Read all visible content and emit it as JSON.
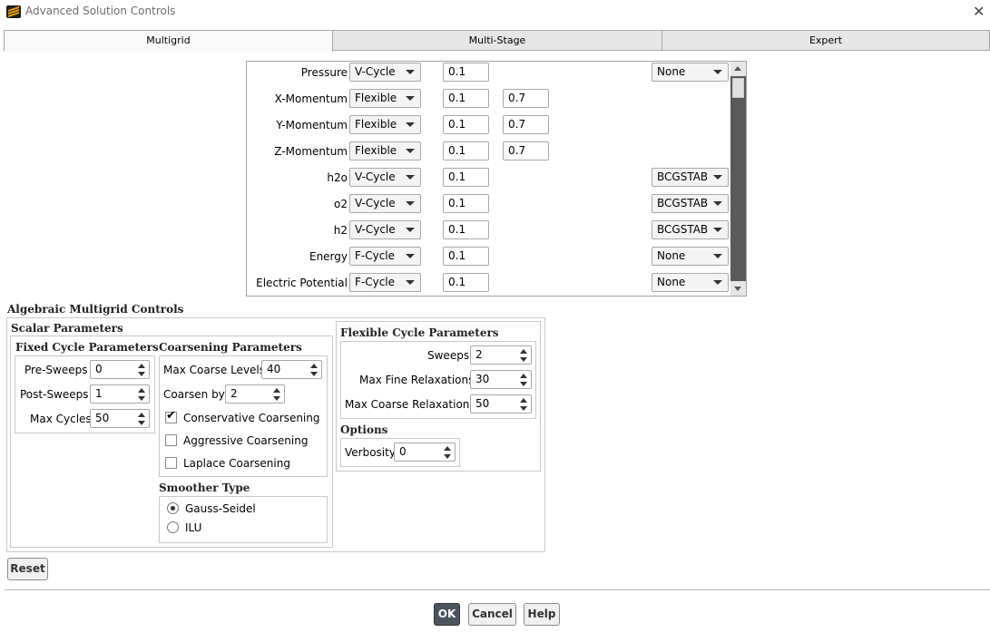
{
  "window": {
    "title": "Advanced Solution Controls",
    "close_glyph": "✕",
    "icon": "app-logo-icon"
  },
  "tabs": [
    {
      "label": "Multigrid",
      "active": true
    },
    {
      "label": "Multi-Stage",
      "active": false
    },
    {
      "label": "Expert",
      "active": false
    }
  ],
  "equations": [
    {
      "name": "Pressure",
      "cycle": "V-Cycle",
      "termination": "0.1",
      "restriction": "",
      "method": "None"
    },
    {
      "name": "X-Momentum",
      "cycle": "Flexible",
      "termination": "0.1",
      "restriction": "0.7",
      "method": ""
    },
    {
      "name": "Y-Momentum",
      "cycle": "Flexible",
      "termination": "0.1",
      "restriction": "0.7",
      "method": ""
    },
    {
      "name": "Z-Momentum",
      "cycle": "Flexible",
      "termination": "0.1",
      "restriction": "0.7",
      "method": ""
    },
    {
      "name": "h2o",
      "cycle": "V-Cycle",
      "termination": "0.1",
      "restriction": "",
      "method": "BCGSTAB"
    },
    {
      "name": "o2",
      "cycle": "V-Cycle",
      "termination": "0.1",
      "restriction": "",
      "method": "BCGSTAB"
    },
    {
      "name": "h2",
      "cycle": "V-Cycle",
      "termination": "0.1",
      "restriction": "",
      "method": "BCGSTAB"
    },
    {
      "name": "Energy",
      "cycle": "F-Cycle",
      "termination": "0.1",
      "restriction": "",
      "method": "None"
    },
    {
      "name": "Electric Potential",
      "cycle": "F-Cycle",
      "termination": "0.1",
      "restriction": "",
      "method": "None"
    }
  ],
  "amg": {
    "title": "Algebraic Multigrid Controls",
    "scalar_title": "Scalar Parameters",
    "fixed": {
      "title": "Fixed Cycle Parameters",
      "pre_label": "Pre-Sweeps",
      "pre_value": "0",
      "post_label": "Post-Sweeps",
      "post_value": "1",
      "max_label": "Max Cycles",
      "max_value": "50"
    },
    "coarsening": {
      "title": "Coarsening Parameters",
      "levels_label": "Max Coarse Levels",
      "levels_value": "40",
      "by_label": "Coarsen by",
      "by_value": "2",
      "conservative_label": "Conservative Coarsening",
      "conservative_checked": true,
      "aggressive_label": "Aggressive Coarsening",
      "aggressive_checked": false,
      "laplace_label": "Laplace Coarsening",
      "laplace_checked": false
    },
    "smoother": {
      "title": "Smoother Type",
      "gauss_label": "Gauss-Seidel",
      "ilu_label": "ILU",
      "selected": "Gauss-Seidel"
    },
    "flexible": {
      "title": "Flexible Cycle Parameters",
      "sweeps_label": "Sweeps",
      "sweeps_value": "2",
      "fine_label": "Max Fine Relaxations",
      "fine_value": "30",
      "coarse_label": "Max Coarse Relaxations",
      "coarse_value": "50"
    },
    "options": {
      "title": "Options",
      "verbosity_label": "Verbosity",
      "verbosity_value": "0"
    }
  },
  "buttons": {
    "reset": "Reset",
    "ok": "OK",
    "cancel": "Cancel",
    "help": "Help"
  }
}
